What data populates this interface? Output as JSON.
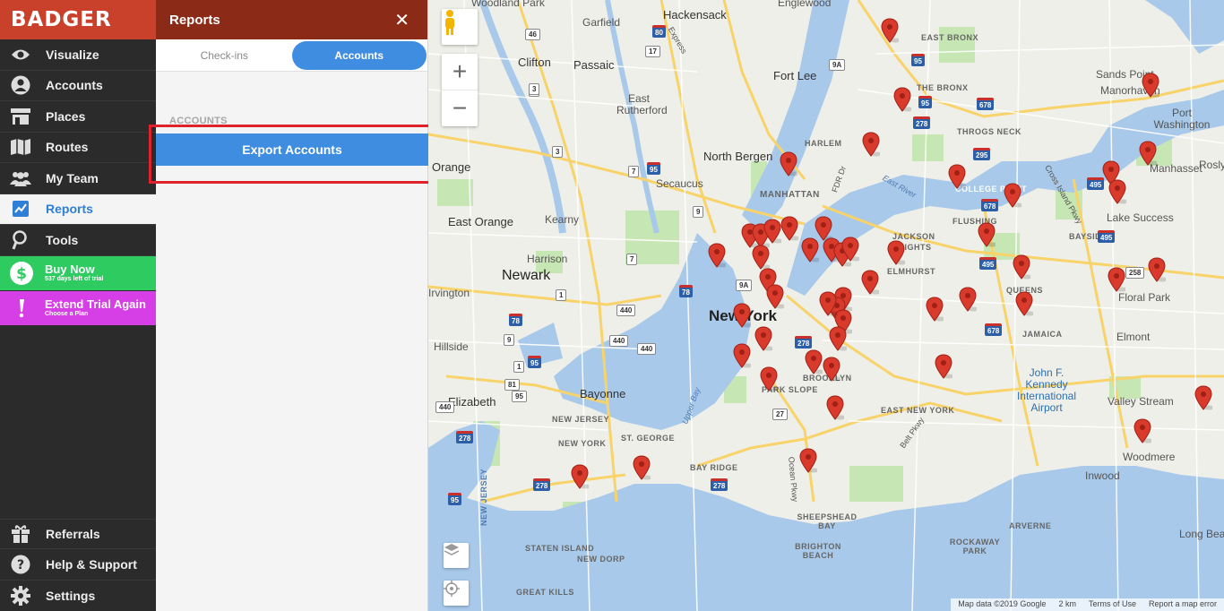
{
  "brand": {
    "name": "BADGER"
  },
  "nav": {
    "items": [
      {
        "label": "Visualize",
        "icon": "eye-icon"
      },
      {
        "label": "Accounts",
        "icon": "user-icon"
      },
      {
        "label": "Places",
        "icon": "store-icon"
      },
      {
        "label": "Routes",
        "icon": "map-icon"
      },
      {
        "label": "My Team",
        "icon": "team-icon"
      },
      {
        "label": "Reports",
        "icon": "chart-icon",
        "active": true
      },
      {
        "label": "Tools",
        "icon": "tools-icon"
      }
    ],
    "buy_now": {
      "title": "Buy Now",
      "subtitle": "537 days left of trial"
    },
    "extend_trial": {
      "title": "Extend Trial Again",
      "subtitle": "Choose a Plan"
    },
    "bottom_items": [
      {
        "label": "Referrals",
        "icon": "gift-icon"
      },
      {
        "label": "Help & Support",
        "icon": "help-icon"
      },
      {
        "label": "Settings",
        "icon": "gear-icon"
      }
    ],
    "colors": {
      "brand": "#c9412a",
      "active": "#2f7fd6",
      "buy": "#2ecc60",
      "extend": "#d63ee6"
    }
  },
  "panel": {
    "title": "Reports",
    "close": "✕",
    "tabs": [
      {
        "label": "Check-ins"
      },
      {
        "label": "Accounts",
        "active": true
      }
    ],
    "section_label": "ACCOUNTS",
    "export_button": "Export Accounts",
    "colors": {
      "header": "#8b2a16",
      "button": "#3f8de0",
      "highlight": "#e0222d"
    }
  },
  "map": {
    "labels": {
      "woodland_park": "Woodland Park",
      "garfield": "Garfield",
      "hackensack": "Hackensack",
      "englewood": "Englewood",
      "clifton": "Clifton",
      "passaic": "Passaic",
      "fort_lee": "Fort Lee",
      "east_bronx": "EAST BRONX",
      "the_bronx": "THE BRONX",
      "sands_point": "Sands Point",
      "manorhaven": "Manorhaven",
      "port_washington": "Port Washington",
      "east_rutherford": "East Rutherford",
      "throgs_neck": "THROGS NECK",
      "harlem": "HARLEM",
      "north_bergen": "North Bergen",
      "orange": "Orange",
      "manhasset": "Manhasset",
      "roslyn": "Rosly",
      "secaucus": "Secaucus",
      "manhattan": "MANHATTAN",
      "fdr_dr": "FDR Dr",
      "east_river": "East River",
      "college_point": "COLLEGE POINT",
      "cross_island": "Cross Island Pkwy",
      "east_orange": "East Orange",
      "kearny": "Kearny",
      "flushing": "FLUSHING",
      "lake_success": "Lake Success",
      "harrison": "Harrison",
      "jackson": "JACKSON",
      "heights": "HEIGHTS",
      "bayside": "BAYSIDE",
      "newark": "Newark",
      "elmhurst": "ELMHURST",
      "irvington": "Irvington",
      "new_york": "New York",
      "queens": "QUEENS",
      "floral_park": "Floral Park",
      "hillside": "Hillside",
      "jamaica": "JAMAICA",
      "elmont": "Elmont",
      "bayonne": "Bayonne",
      "brooklyn": "BROOKLYN",
      "park_slope": "PARK SLOPE",
      "upper_bay": "Upper Bay",
      "elizabeth": "Elizabeth",
      "jfk": "John F. Kennedy International Airport",
      "valley_stream": "Valley Stream",
      "new_jersey": "NEW JERSEY",
      "east_new_york": "EAST NEW YORK",
      "new_york_small": "NEW YORK",
      "st_george": "ST. GEORGE",
      "belt_pkwy": "Belt Pkwy",
      "woodmere": "Woodmere",
      "bay_ridge": "BAY RIDGE",
      "ocean_pkwy": "Ocean Pkwy",
      "inwood": "Inwood",
      "sheepshead_bay": "SHEEPSHEAD BAY",
      "new_jersey_vertical": "NEW JERSEY",
      "arverne": "ARVERNE",
      "staten_island": "STATEN ISLAND",
      "brighton_beach": "BRIGHTON BEACH",
      "rockaway_park": "ROCKAWAY PARK",
      "long_beach": "Long Bea",
      "new_dorp": "NEW DORP",
      "great_kills": "GREAT KILLS",
      "express": "Express"
    },
    "shields": [
      "46",
      "4",
      "3",
      "80",
      "17",
      "9A",
      "95",
      "95",
      "678",
      "295",
      "278",
      "7",
      "3",
      "95",
      "495",
      "678",
      "9",
      "495",
      "7",
      "9A",
      "495",
      "440",
      "78",
      "258",
      "1",
      "9",
      "78",
      "95",
      "440",
      "278",
      "678",
      "440",
      "81",
      "95",
      "27",
      "440",
      "278",
      "278",
      "95",
      "1",
      "278"
    ],
    "attribution": {
      "map_data": "Map data ©2019 Google",
      "scale": "2 km",
      "terms": "Terms of Use",
      "report": "Report a map error"
    },
    "pin_count": 66,
    "colors": {
      "water": "#a8c9ea",
      "land": "#efefe9",
      "park": "#c6e6b3",
      "highway": "#f8d36a",
      "pin": "#d93a2b"
    }
  }
}
